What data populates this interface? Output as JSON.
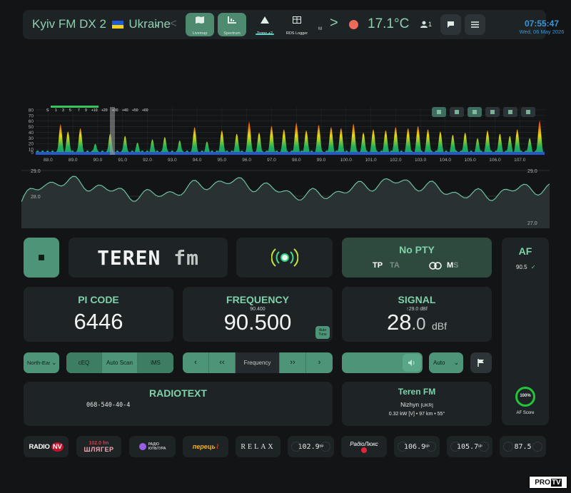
{
  "topbar": {
    "station_title_pre": "Kyiv FM DX 2",
    "station_title_post": "Ukraine",
    "caret": "⌄",
    "prev": "<",
    "next": ">",
    "nav": [
      {
        "id": "livemap",
        "label": "Livemap",
        "active": true
      },
      {
        "id": "spectrum",
        "label": "Spectrum",
        "active": true
      },
      {
        "id": "tropo",
        "label": "Tropo +2",
        "active": false
      },
      {
        "id": "rdslogger",
        "label": "RDS Logger",
        "active": false
      }
    ],
    "m_label": "M",
    "temperature": "17.1°C",
    "users_count": "1",
    "clock_time": "07:55:47",
    "clock_date": "Wed, 06 May 2026"
  },
  "spectrum": {
    "y_ticks": [
      "80",
      "70",
      "60",
      "50",
      "40",
      "30",
      "20",
      "10",
      "5"
    ],
    "x_ticks": [
      "88.0",
      "89.0",
      "90.0",
      "91.0",
      "92.0",
      "93.0",
      "94.0",
      "95.0",
      "96.0",
      "97.0",
      "98.0",
      "99.0",
      "100.0",
      "101.0",
      "102.0",
      "103.0",
      "104.0",
      "105.0",
      "106.0",
      "107.0"
    ],
    "s_scale": [
      "S",
      "1",
      "3",
      "5",
      "7",
      "9",
      "+10",
      "+20",
      "+30",
      "+40",
      "+50",
      "+60"
    ],
    "colors": {
      "high": "#e0241a",
      "mid": "#e8d80e",
      "low": "#1fb05a",
      "base": "#2a57c8"
    }
  },
  "signal_history": {
    "y_top": "29.0",
    "y_mid": "28.0",
    "y_bottom": "27.0"
  },
  "ps_text": "TEREN fm",
  "pty": {
    "title": "No PTY",
    "tp": "TP",
    "ta": "TA",
    "stereo_icon": "stereo-rings-icon",
    "ms_m": "M",
    "ms_s": "S"
  },
  "af": {
    "title": "AF",
    "list": [
      {
        "freq": "90.5",
        "mark": "✓"
      }
    ],
    "score": "100%",
    "score_label": "AF Score"
  },
  "pi": {
    "title": "PI CODE",
    "value": "6446"
  },
  "frequency": {
    "title": "FREQUENCY",
    "previous": "90.400",
    "value": "90.500",
    "autotune": "Auto Tune"
  },
  "signal": {
    "title": "SIGNAL",
    "peak": "↑29.0 dBf",
    "value_int": "28",
    "value_dec": ".0",
    "unit": "dBf"
  },
  "controls": {
    "antenna": "North-East",
    "ceq": "cEQ",
    "autoscan": "Auto Scan",
    "ims": "iMS",
    "freq_label": "Frequency",
    "bw": "Auto"
  },
  "radiotext": {
    "title": "RADIOTEXT",
    "line": "068-540-40-4"
  },
  "tx": {
    "name": "Teren FM",
    "city": "Nizhyn",
    "country": "[UKR]",
    "details": "0.32 kW [V] • 97 km • 55°"
  },
  "presets": [
    {
      "type": "logo",
      "text": "RADIO NV"
    },
    {
      "type": "logo",
      "text": "ШЛЯГЕР"
    },
    {
      "type": "logo",
      "text": "РАДІО КУЛЬТУРА"
    },
    {
      "type": "logo",
      "text": "ПЕРЕЦЬ FM"
    },
    {
      "type": "logo",
      "text": "RELAX"
    },
    {
      "type": "freq",
      "text": "102.9",
      "sup": "M²"
    },
    {
      "type": "logo",
      "text": "Радіо Люкс"
    },
    {
      "type": "freq",
      "text": "106.9",
      "sup": "M²"
    },
    {
      "type": "freq",
      "text": "105.7",
      "sup": "M²"
    },
    {
      "type": "freq",
      "text": "87.5",
      "sup": ""
    }
  ],
  "watermark": "PRO TV"
}
